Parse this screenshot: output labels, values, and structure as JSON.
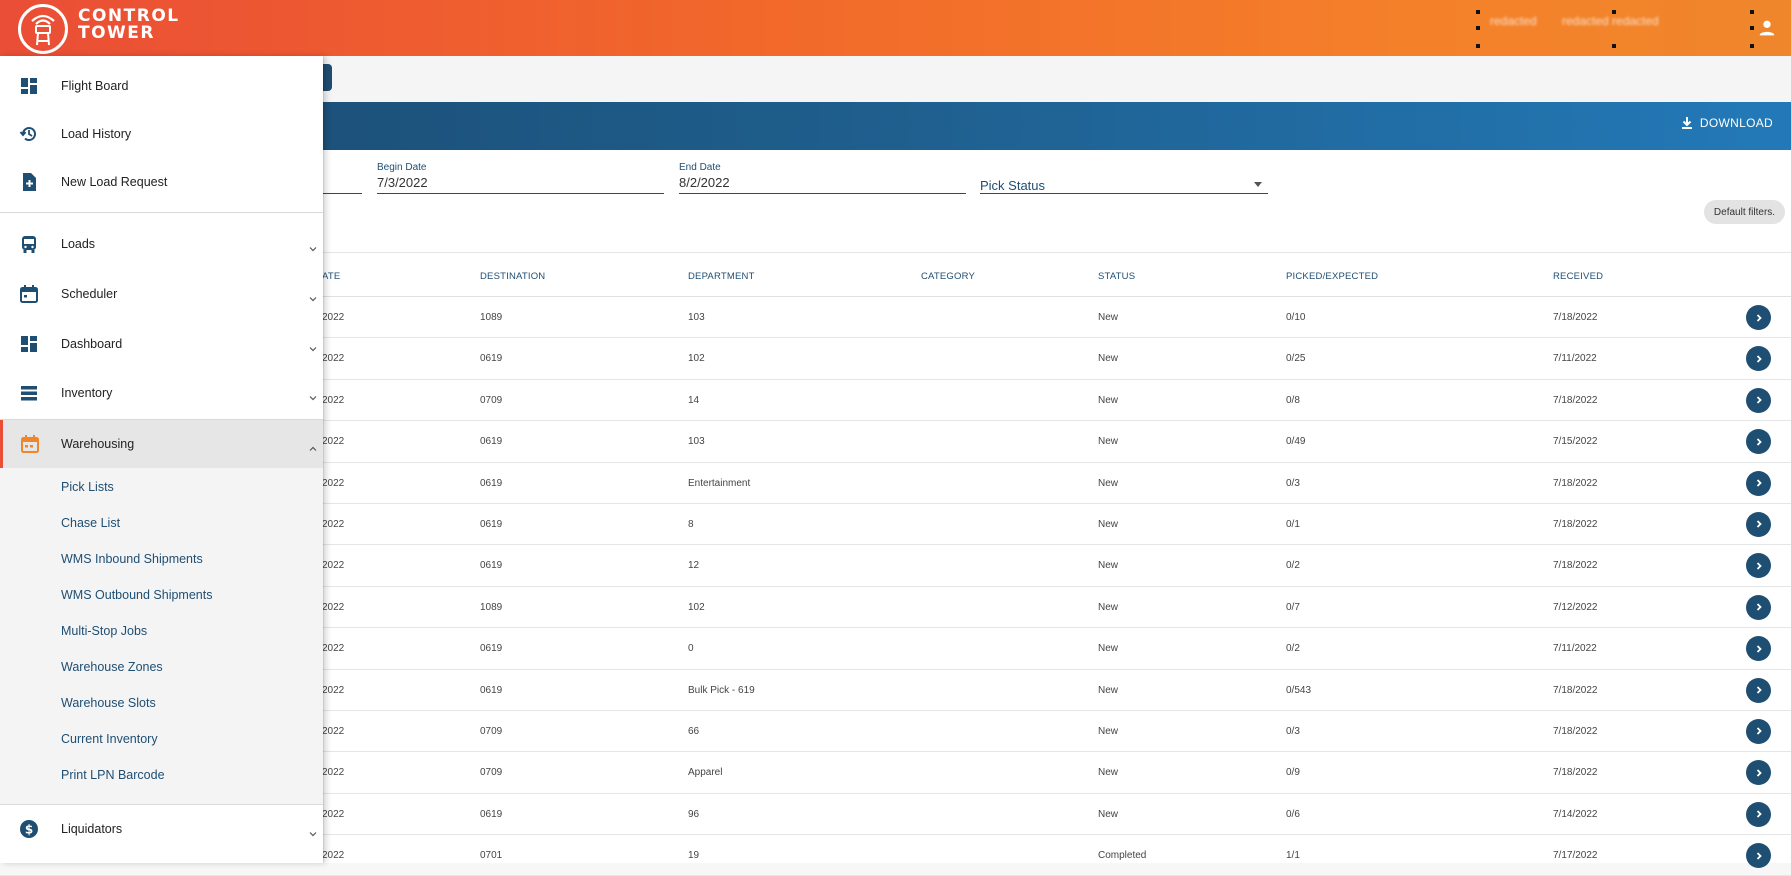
{
  "header": {
    "logo_line1": "CONTROL",
    "logo_line2": "TOWER",
    "user_blur_1": "redacted",
    "user_blur_2": "redacted redacted",
    "account_icon": "account-icon",
    "brand_color": "#ea4e36"
  },
  "toolbar": {
    "download_label": "DOWNLOAD",
    "download_icon": "download-icon"
  },
  "filters": {
    "begin_date_label": "Begin Date",
    "begin_date_value": "7/3/2022",
    "end_date_label": "End Date",
    "end_date_value": "8/2/2022",
    "pick_status_label": "Pick Status",
    "default_filters_chip": "Default filters."
  },
  "table": {
    "columns": [
      "ATE",
      "DESTINATION",
      "DEPARTMENT",
      "CATEGORY",
      "STATUS",
      "PICKED/EXPECTED",
      "RECEIVED"
    ],
    "rows": [
      {
        "date": "2022",
        "destination": "1089",
        "department": "103",
        "category": "",
        "status": "New",
        "picked": "0/10",
        "received": "7/18/2022"
      },
      {
        "date": "2022",
        "destination": "0619",
        "department": "102",
        "category": "",
        "status": "New",
        "picked": "0/25",
        "received": "7/11/2022"
      },
      {
        "date": "2022",
        "destination": "0709",
        "department": "14",
        "category": "",
        "status": "New",
        "picked": "0/8",
        "received": "7/18/2022"
      },
      {
        "date": "2022",
        "destination": "0619",
        "department": "103",
        "category": "",
        "status": "New",
        "picked": "0/49",
        "received": "7/15/2022"
      },
      {
        "date": "2022",
        "destination": "0619",
        "department": "Entertainment",
        "category": "",
        "status": "New",
        "picked": "0/3",
        "received": "7/18/2022"
      },
      {
        "date": "2022",
        "destination": "0619",
        "department": "8",
        "category": "",
        "status": "New",
        "picked": "0/1",
        "received": "7/18/2022"
      },
      {
        "date": "2022",
        "destination": "0619",
        "department": "12",
        "category": "",
        "status": "New",
        "picked": "0/2",
        "received": "7/18/2022"
      },
      {
        "date": "2022",
        "destination": "1089",
        "department": "102",
        "category": "",
        "status": "New",
        "picked": "0/7",
        "received": "7/12/2022"
      },
      {
        "date": "2022",
        "destination": "0619",
        "department": "0",
        "category": "",
        "status": "New",
        "picked": "0/2",
        "received": "7/11/2022"
      },
      {
        "date": "2022",
        "destination": "0619",
        "department": "Bulk Pick - 619",
        "category": "",
        "status": "New",
        "picked": "0/543",
        "received": "7/18/2022"
      },
      {
        "date": "2022",
        "destination": "0709",
        "department": "66",
        "category": "",
        "status": "New",
        "picked": "0/3",
        "received": "7/18/2022"
      },
      {
        "date": "2022",
        "destination": "0709",
        "department": "Apparel",
        "category": "",
        "status": "New",
        "picked": "0/9",
        "received": "7/18/2022"
      },
      {
        "date": "2022",
        "destination": "0619",
        "department": "96",
        "category": "",
        "status": "New",
        "picked": "0/6",
        "received": "7/14/2022"
      },
      {
        "date": "2022",
        "destination": "0701",
        "department": "19",
        "category": "",
        "status": "Completed",
        "picked": "1/1",
        "received": "7/17/2022"
      }
    ]
  },
  "drawer": {
    "top_items": [
      {
        "label": "Flight Board",
        "icon": "dashboard-icon"
      },
      {
        "label": "Load History",
        "icon": "history-icon"
      },
      {
        "label": "New Load Request",
        "icon": "add-file-icon"
      }
    ],
    "sections": [
      {
        "label": "Loads",
        "icon": "bus-icon"
      },
      {
        "label": "Scheduler",
        "icon": "calendar-icon"
      },
      {
        "label": "Dashboard",
        "icon": "dashboard-icon"
      },
      {
        "label": "Inventory",
        "icon": "list-icon"
      },
      {
        "label": "Warehousing",
        "icon": "warehouse-calendar-icon",
        "active": true
      },
      {
        "label": "Liquidators",
        "icon": "dollar-icon"
      }
    ],
    "warehousing_items": [
      "Pick Lists",
      "Chase List",
      "WMS Inbound Shipments",
      "WMS Outbound Shipments",
      "Multi-Stop Jobs",
      "Warehouse Zones",
      "Warehouse Slots",
      "Current Inventory",
      "Print LPN Barcode"
    ]
  }
}
